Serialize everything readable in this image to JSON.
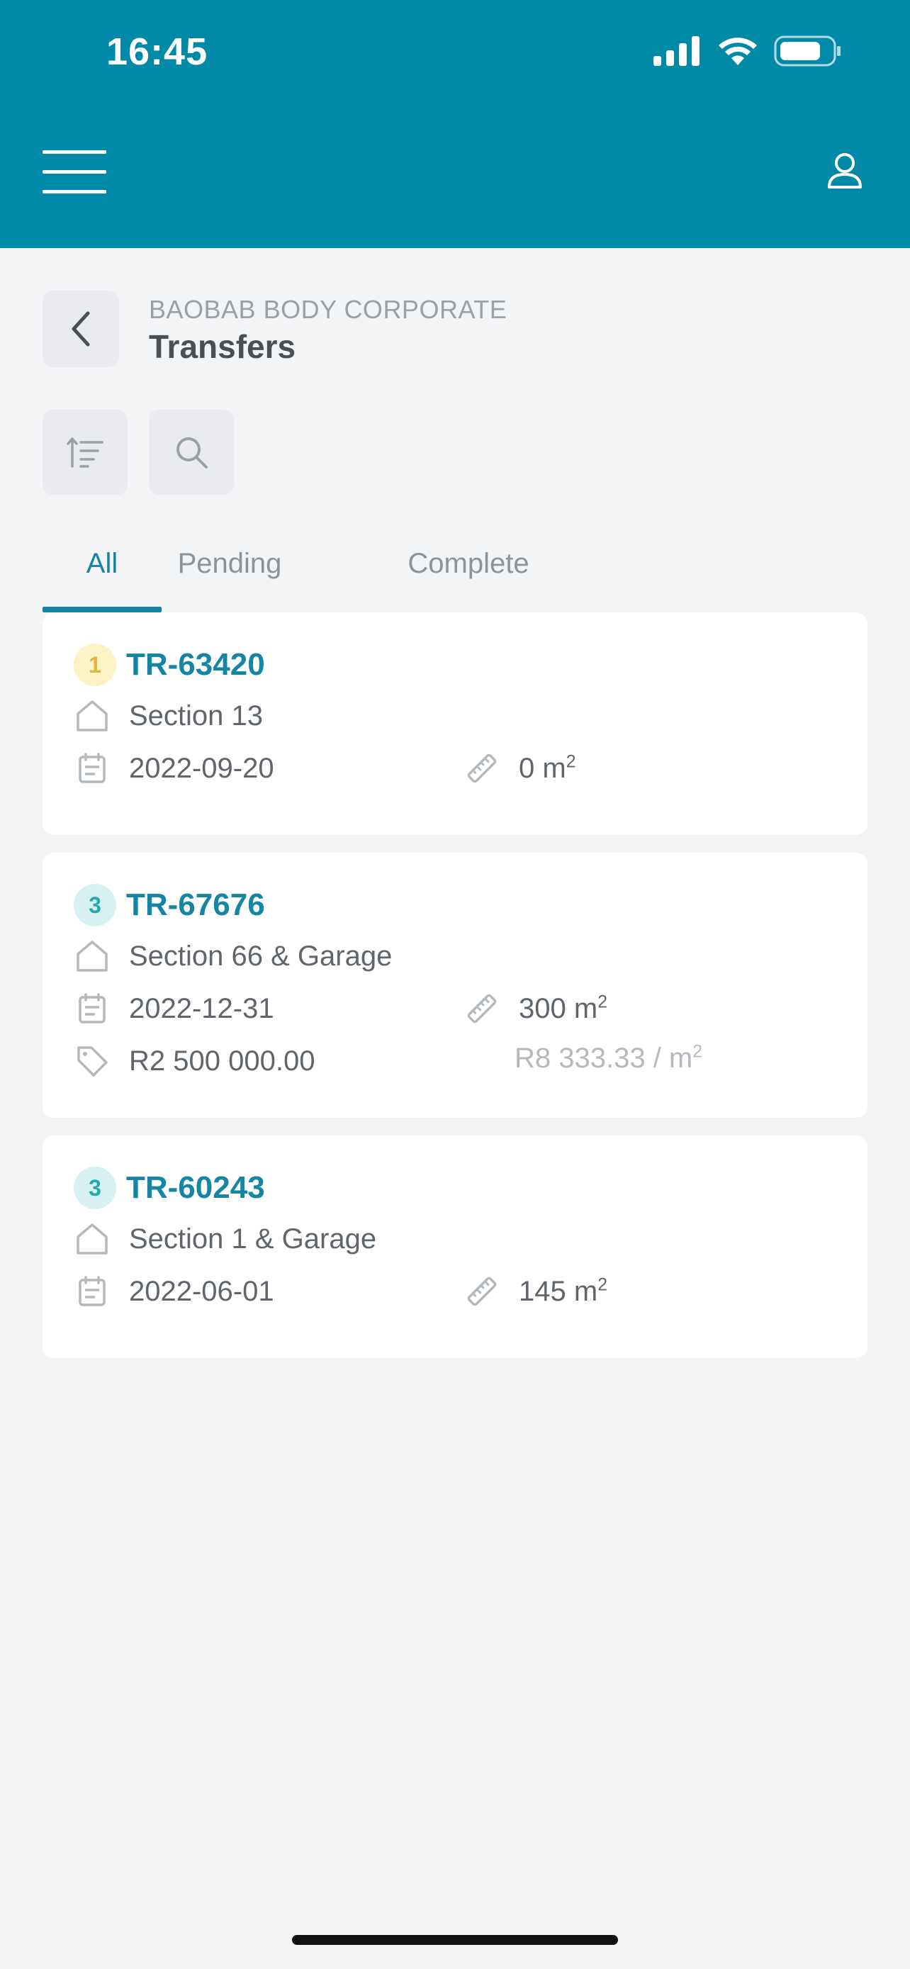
{
  "status_bar": {
    "time": "16:45"
  },
  "page": {
    "subtitle": "BAOBAB BODY CORPORATE",
    "title": "Transfers"
  },
  "tabs": [
    {
      "label": "All",
      "active": true
    },
    {
      "label": "Pending",
      "active": false
    },
    {
      "label": "Complete",
      "active": false
    }
  ],
  "colors": {
    "header": "#018aa8",
    "accent": "#1585a4",
    "background": "#f3f4f6"
  },
  "transfers": [
    {
      "badge": "1",
      "badge_color": "yellow",
      "ref": "TR-63420",
      "section": "Section 13",
      "date": "2022-09-20",
      "area": "0",
      "area_unit": "m",
      "area_exp": "2"
    },
    {
      "badge": "3",
      "badge_color": "teal",
      "ref": "TR-67676",
      "section": "Section 66 & Garage",
      "date": "2022-12-31",
      "area": "300",
      "area_unit": "m",
      "area_exp": "2",
      "price": "R2 500 000.00",
      "price_per": "R8 333.33 / m",
      "price_per_exp": "2"
    },
    {
      "badge": "3",
      "badge_color": "teal",
      "ref": "TR-60243",
      "section": "Section 1 & Garage",
      "date": "2022-06-01",
      "area": "145",
      "area_unit": "m",
      "area_exp": "2"
    }
  ]
}
